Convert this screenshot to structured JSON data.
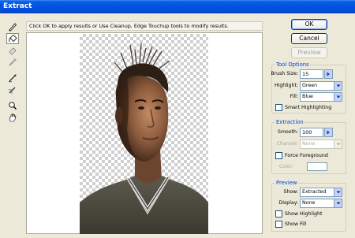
{
  "window": {
    "title": "Extract"
  },
  "instruction": "Click OK to apply results or Use Cleanup, Edge Touchup tools to modify results.",
  "toolbox": [
    {
      "name": "edge-highlighter-icon"
    },
    {
      "name": "fill-bucket-icon"
    },
    {
      "name": "eraser-icon"
    },
    {
      "name": "eyedropper-icon"
    },
    {
      "name": "cleanup-icon"
    },
    {
      "name": "edge-touchup-icon"
    },
    {
      "name": "zoom-icon"
    },
    {
      "name": "hand-icon"
    }
  ],
  "buttons": {
    "ok": "OK",
    "cancel": "Cancel",
    "preview": "Preview"
  },
  "tool_options": {
    "title": "Tool Options",
    "brush_size_label": "Brush Size:",
    "brush_size": "15",
    "highlight_label": "Highlight:",
    "highlight": "Green",
    "fill_label": "Fill:",
    "fill": "Blue",
    "smart_highlighting": "Smart Highlighting"
  },
  "extraction": {
    "title": "Extraction",
    "smooth_label": "Smooth:",
    "smooth": "100",
    "channel_label": "Channel:",
    "channel": "None",
    "force_foreground": "Force Foreground",
    "color_label": "Color:"
  },
  "preview": {
    "title": "Preview",
    "show_label": "Show:",
    "show": "Extracted",
    "display_label": "Display:",
    "display": "None",
    "show_highlight": "Show Highlight",
    "show_fill": "Show Fill"
  },
  "colors": {
    "title_bar": "#0054e3",
    "group_title": "#0046d5",
    "checker": "#cfcfcf"
  }
}
